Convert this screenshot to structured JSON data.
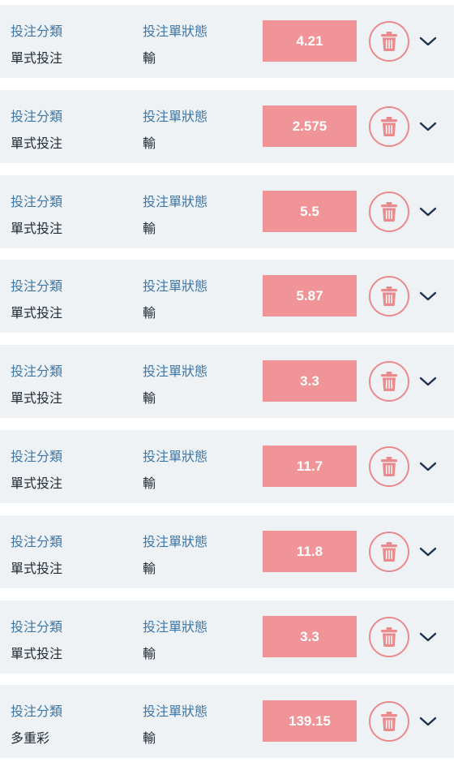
{
  "colors": {
    "card_bg": "#eef2f5",
    "label_blue": "#3d77a8",
    "value_text": "#222b33",
    "amount_bg": "#f19497",
    "delete_red": "#ea8a8c",
    "chevron": "#1d3250"
  },
  "icons": {
    "delete": "trash-icon",
    "expand": "chevron-down-icon"
  },
  "bets": [
    {
      "type_label": "投注分類",
      "type_value": "單式投注",
      "status_label": "投注單狀態",
      "status_value": "輸",
      "amount": "4.21"
    },
    {
      "type_label": "投注分類",
      "type_value": "單式投注",
      "status_label": "投注單狀態",
      "status_value": "輸",
      "amount": "2.575"
    },
    {
      "type_label": "投注分類",
      "type_value": "單式投注",
      "status_label": "投注單狀態",
      "status_value": "輸",
      "amount": "5.5"
    },
    {
      "type_label": "投注分類",
      "type_value": "單式投注",
      "status_label": "投注單狀態",
      "status_value": "輸",
      "amount": "5.87"
    },
    {
      "type_label": "投注分類",
      "type_value": "單式投注",
      "status_label": "投注單狀態",
      "status_value": "輸",
      "amount": "3.3"
    },
    {
      "type_label": "投注分類",
      "type_value": "單式投注",
      "status_label": "投注單狀態",
      "status_value": "輸",
      "amount": "11.7"
    },
    {
      "type_label": "投注分類",
      "type_value": "單式投注",
      "status_label": "投注單狀態",
      "status_value": "輸",
      "amount": "11.8"
    },
    {
      "type_label": "投注分類",
      "type_value": "單式投注",
      "status_label": "投注單狀態",
      "status_value": "輸",
      "amount": "3.3"
    },
    {
      "type_label": "投注分類",
      "type_value": "多重彩",
      "status_label": "投注單狀態",
      "status_value": "輸",
      "amount": "139.15"
    }
  ]
}
